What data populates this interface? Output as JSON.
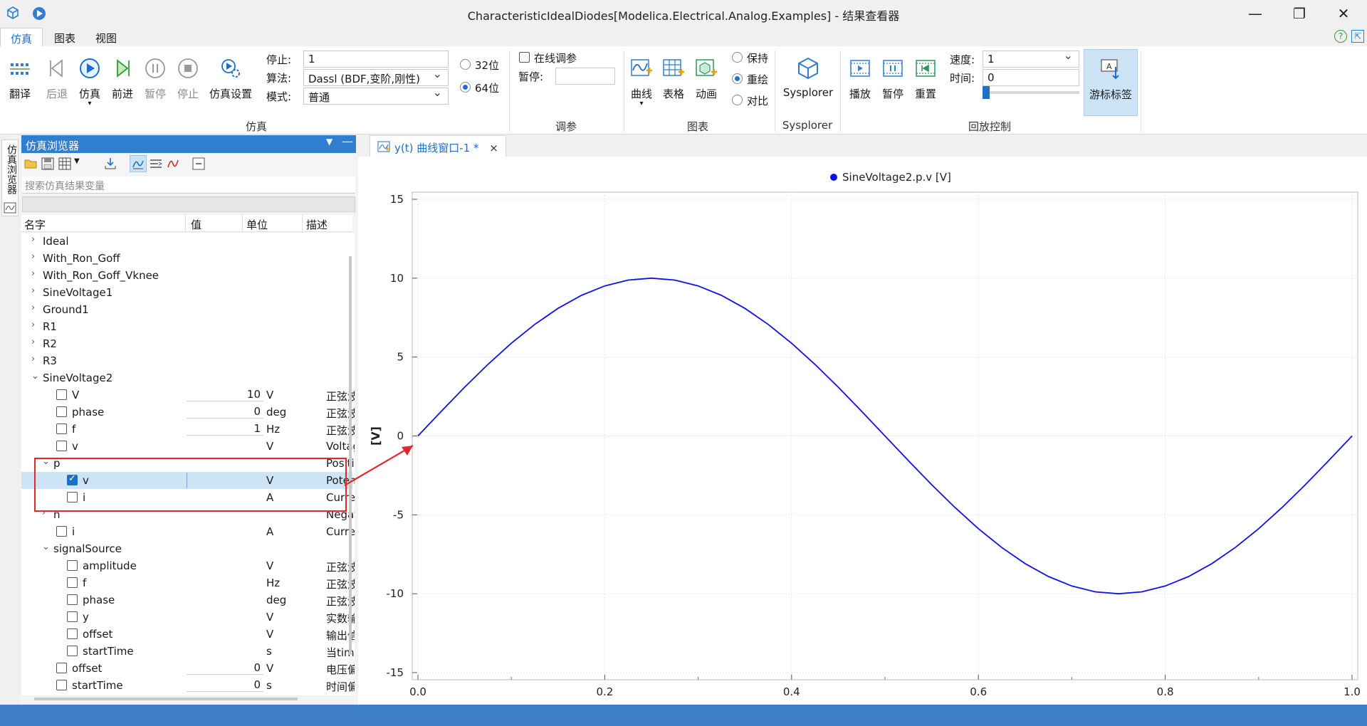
{
  "window": {
    "title": "CharacteristicIdealDiodes[Modelica.Electrical.Analog.Examples] - 结果查看器",
    "minimize_glyph": "—",
    "restore_glyph": "❐",
    "close_glyph": "✕",
    "help_glyph": "?",
    "expand_glyph": "⇱"
  },
  "menu": {
    "tabs": [
      "仿真",
      "图表",
      "视图"
    ],
    "active": 0
  },
  "ribbon": {
    "sim_buttons": [
      {
        "label": "翻译",
        "icon": "translate-icon",
        "enabled": true
      },
      {
        "label": "后退",
        "icon": "step-back-icon",
        "enabled": false
      },
      {
        "label": "仿真",
        "icon": "simulate-play-icon",
        "enabled": true
      },
      {
        "label": "前进",
        "icon": "step-forward-icon",
        "enabled": true
      },
      {
        "label": "暂停",
        "icon": "pause-icon",
        "enabled": false
      },
      {
        "label": "停止",
        "icon": "stop-icon",
        "enabled": false
      },
      {
        "label": "仿真设置",
        "icon": "sim-settings-gear-icon",
        "enabled": true
      }
    ],
    "stop_label": "停止:",
    "stop_value": "1",
    "algo_label": "算法:",
    "algo_value": "Dassl (BDF,变阶,刚性)",
    "mode_label": "模式:",
    "mode_value": "普通",
    "bits32": "32位",
    "bits64": "64位",
    "bits_selected": "64位",
    "sim_group": "仿真",
    "tune_online": "在线调参",
    "tune_online_checked": false,
    "pause_label": "暂停:",
    "pause_value": "",
    "tune_group": "调参",
    "chart_buttons": [
      {
        "label": "曲线",
        "icon": "curve-add-icon"
      },
      {
        "label": "表格",
        "icon": "table-add-icon"
      },
      {
        "label": "动画",
        "icon": "animation-add-icon"
      }
    ],
    "keep": "保持",
    "redraw": "重绘",
    "compare": "对比",
    "redraw_mode_selected": "重绘",
    "chart_group": "图表",
    "sysplorer_label": "Sysplorer",
    "sysplorer_group": "Sysplorer",
    "playback_buttons": [
      {
        "label": "播放",
        "icon": "play-film-icon"
      },
      {
        "label": "暂停",
        "icon": "pause-film-icon"
      },
      {
        "label": "重置",
        "icon": "reset-film-icon"
      }
    ],
    "speed_label": "速度:",
    "speed_value": "1",
    "time_label": "时间:",
    "time_value": "0",
    "time_slider_fraction": 0.0,
    "cursor_label": "游标标签",
    "playback_group": "回放控制"
  },
  "browser": {
    "side_tab": "仿真浏览器",
    "title": "仿真浏览器",
    "search_placeholder": "搜索仿真结果变量",
    "columns": [
      "名字",
      "值",
      "单位",
      "描述"
    ],
    "rows": [
      {
        "indent": 0,
        "arrow": "›",
        "name": "Ideal"
      },
      {
        "indent": 0,
        "arrow": "›",
        "name": "With_Ron_Goff"
      },
      {
        "indent": 0,
        "arrow": "›",
        "name": "With_Ron_Goff_Vknee"
      },
      {
        "indent": 0,
        "arrow": "›",
        "name": "SineVoltage1"
      },
      {
        "indent": 0,
        "arrow": "›",
        "name": "Ground1"
      },
      {
        "indent": 0,
        "arrow": "›",
        "name": "R1"
      },
      {
        "indent": 0,
        "arrow": "›",
        "name": "R2"
      },
      {
        "indent": 0,
        "arrow": "›",
        "name": "R3"
      },
      {
        "indent": 0,
        "arrow": "⌄",
        "name": "SineVoltage2"
      },
      {
        "indent": 1,
        "check": false,
        "name": "V",
        "value": "10",
        "unit": "V",
        "desc": "正弦波的"
      },
      {
        "indent": 1,
        "check": false,
        "name": "phase",
        "value": "0",
        "unit": "deg",
        "desc": "正弦波的"
      },
      {
        "indent": 1,
        "check": false,
        "name": "f",
        "value": "1",
        "unit": "Hz",
        "desc": "正弦波频"
      },
      {
        "indent": 1,
        "check": false,
        "name": "v",
        "unit": "V",
        "desc": "Voltage"
      },
      {
        "indent": 1,
        "arrow": "⌄",
        "name": "p",
        "desc": "Positive"
      },
      {
        "indent": 2,
        "check": true,
        "name": "v",
        "unit": "V",
        "desc": "Potenti",
        "selected": true
      },
      {
        "indent": 2,
        "check": false,
        "name": "i",
        "unit": "A",
        "desc": "Current"
      },
      {
        "indent": 1,
        "arrow": "›",
        "name": "n",
        "desc": "Negativ"
      },
      {
        "indent": 1,
        "check": false,
        "name": "i",
        "unit": "A",
        "desc": "Current"
      },
      {
        "indent": 1,
        "arrow": "⌄",
        "name": "signalSource"
      },
      {
        "indent": 2,
        "check": false,
        "name": "amplitude",
        "unit": "V",
        "desc": "正弦波振"
      },
      {
        "indent": 2,
        "check": false,
        "name": "f",
        "unit": "Hz",
        "desc": "正弦波频"
      },
      {
        "indent": 2,
        "check": false,
        "name": "phase",
        "unit": "deg",
        "desc": "正弦波相"
      },
      {
        "indent": 2,
        "check": false,
        "name": "y",
        "unit": "V",
        "desc": "实数输出"
      },
      {
        "indent": 2,
        "check": false,
        "name": "offset",
        "unit": "V",
        "desc": "输出信号"
      },
      {
        "indent": 2,
        "check": false,
        "name": "startTime",
        "unit": "s",
        "desc": "当time ·"
      },
      {
        "indent": 1,
        "check": false,
        "name": "offset",
        "value": "0",
        "unit": "V",
        "desc": "电压偏移"
      },
      {
        "indent": 1,
        "check": false,
        "name": "startTime",
        "value": "0",
        "unit": "s",
        "desc": "时间偏移"
      }
    ]
  },
  "document": {
    "tab_title": "y(t) 曲线窗口-1 *",
    "tab_close": "×"
  },
  "chart_data": {
    "type": "line",
    "legend": "SineVoltage2.p.v [V]",
    "legend_position": "top-center",
    "ylabel": "[V]",
    "xlabel": "",
    "xlim": [
      0.0,
      1.0
    ],
    "ylim": [
      -15,
      15
    ],
    "xticks": [
      0.0,
      0.2,
      0.4,
      0.6,
      0.8,
      1.0
    ],
    "xtick_labels": [
      "0.0",
      "0.2",
      "0.4",
      "0.6",
      "0.8",
      "1.0"
    ],
    "yticks": [
      15,
      10,
      5,
      0,
      -5,
      -10,
      -15
    ],
    "ytick_labels": [
      "15",
      "10",
      "5",
      "0",
      "-5",
      "-10",
      "-15"
    ],
    "grid": true,
    "series": [
      {
        "name": "SineVoltage2.p.v [V]",
        "color": "#1010ee",
        "x": [
          0.0,
          0.025,
          0.05,
          0.075,
          0.1,
          0.125,
          0.15,
          0.175,
          0.2,
          0.225,
          0.25,
          0.275,
          0.3,
          0.325,
          0.35,
          0.375,
          0.4,
          0.425,
          0.45,
          0.475,
          0.5,
          0.525,
          0.55,
          0.575,
          0.6,
          0.625,
          0.65,
          0.675,
          0.7,
          0.725,
          0.75,
          0.775,
          0.8,
          0.825,
          0.85,
          0.875,
          0.9,
          0.925,
          0.95,
          0.975,
          1.0
        ],
        "y": [
          0.0,
          1.56,
          3.09,
          4.54,
          5.88,
          7.07,
          8.09,
          8.91,
          9.51,
          9.88,
          10.0,
          9.88,
          9.51,
          8.91,
          8.09,
          7.07,
          5.88,
          4.54,
          3.09,
          1.56,
          0.0,
          -1.56,
          -3.09,
          -4.54,
          -5.88,
          -7.07,
          -8.09,
          -8.91,
          -9.51,
          -9.88,
          -10.0,
          -9.88,
          -9.51,
          -8.91,
          -8.09,
          -7.07,
          -5.88,
          -4.54,
          -3.09,
          -1.56,
          0.0
        ]
      }
    ]
  },
  "colors": {
    "accent": "#1e6fc8",
    "status_bar": "#3f7fca",
    "annotation_red": "#e0282e",
    "curve": "#1010ee"
  }
}
